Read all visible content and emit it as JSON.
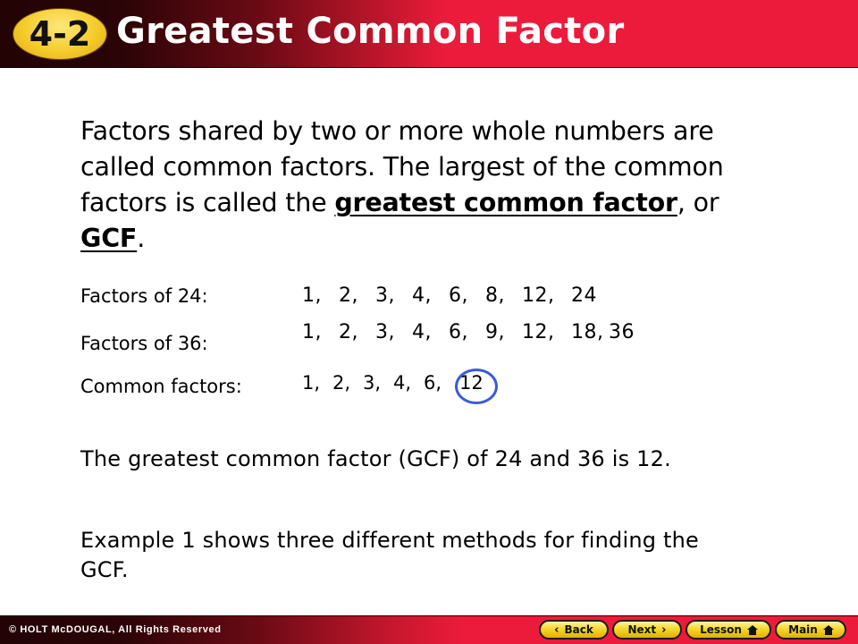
{
  "header": {
    "badge": "4-2",
    "title": "Greatest Common Factor",
    "colors": {
      "header_red": "#ec1b3b",
      "header_dark": "#230305",
      "badge_yellow": "#f5cc2c"
    }
  },
  "intro": {
    "part1": "Factors shared by two or more whole numbers are called common factors. The largest of the common factors is called the ",
    "term1": "greatest common factor",
    "part2": ", or ",
    "term2": "GCF",
    "part3": "."
  },
  "factors": {
    "rows": [
      {
        "label": "Factors of 24:",
        "values": [
          "1,",
          "2,",
          "3,",
          "4,",
          "6,",
          "8,",
          "12,",
          "24"
        ]
      },
      {
        "label": "Factors of 36:",
        "values": [
          "1,",
          "2,",
          "3,",
          "4,",
          "6,",
          "9,",
          "12,",
          "18,",
          "36"
        ]
      },
      {
        "label": "Common factors:",
        "values": [
          "1,",
          "2,",
          "3,",
          "4,",
          "6,"
        ],
        "highlight": "12"
      }
    ],
    "highlight_color": "#3a5bd9"
  },
  "paragraphs": [
    "The greatest common factor (GCF) of 24 and 36 is 12.",
    "Example 1 shows three different methods for finding the GCF."
  ],
  "footer": {
    "copyright": "© HOLT McDOUGAL, All Rights Reserved",
    "buttons": {
      "back": "Back",
      "next": "Next",
      "lesson": "Lesson",
      "main": "Main"
    },
    "icons": {
      "back": "‹",
      "next": "›"
    }
  }
}
